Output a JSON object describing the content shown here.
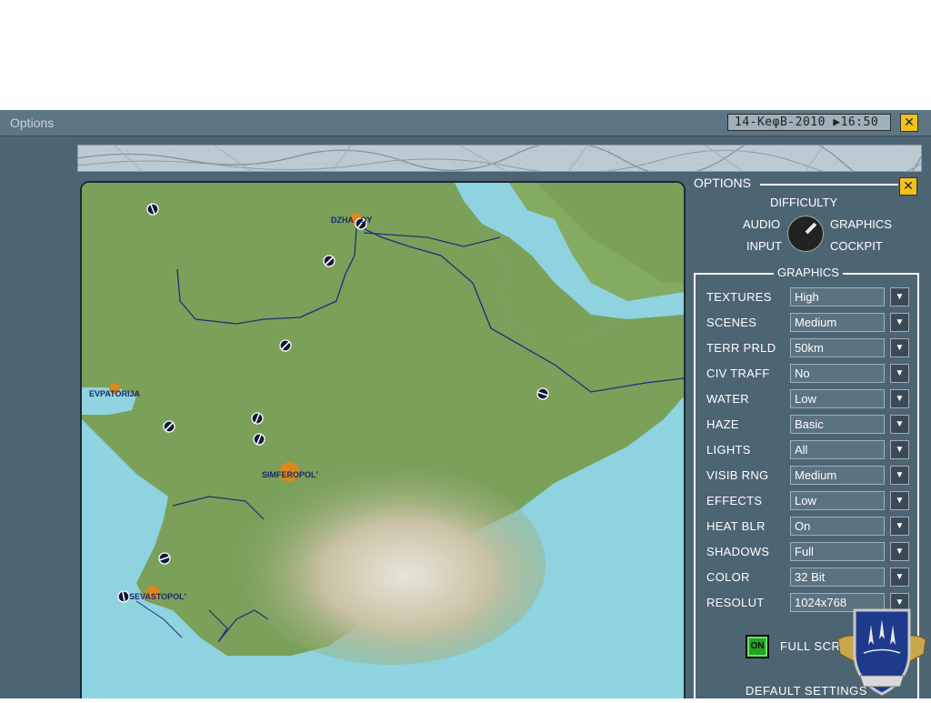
{
  "window": {
    "title": "Options",
    "datetime": "14-KeφB-2010 ▶16:50",
    "close_glyph": "✕"
  },
  "map": {
    "cities": [
      {
        "name": "DZHANKOY",
        "display": "DZHA    OY"
      },
      {
        "name": "EVPATORIJA",
        "display": "EVPATORIJA"
      },
      {
        "name": "SIMFEROPOL'",
        "display": "SIMFEROPOL'"
      },
      {
        "name": "SEVASTOPOL'",
        "display": "SEVASTOPOL'"
      }
    ]
  },
  "options": {
    "title": "OPTIONS",
    "close_glyph": "✕",
    "categories": {
      "difficulty": "DIFFICULTY",
      "audio": "AUDIO",
      "graphics": "GRAPHICS",
      "input": "INPUT",
      "cockpit": "COCKPIT"
    },
    "selected_category": "GRAPHICS"
  },
  "graphics": {
    "title": "GRAPHICS",
    "dropdown_glyph": "▼",
    "rows": [
      {
        "label": "TEXTURES",
        "value": "High"
      },
      {
        "label": "SCENES",
        "value": "Medium"
      },
      {
        "label": "TERR PRLD",
        "value": "50km"
      },
      {
        "label": "CIV TRAFF",
        "value": "No"
      },
      {
        "label": "WATER",
        "value": "Low"
      },
      {
        "label": "HAZE",
        "value": "Basic"
      },
      {
        "label": "LIGHTS",
        "value": "All"
      },
      {
        "label": "VISIB RNG",
        "value": "Medium"
      },
      {
        "label": "EFFECTS",
        "value": "Low"
      },
      {
        "label": "HEAT BLR",
        "value": "On"
      },
      {
        "label": "SHADOWS",
        "value": "Full"
      },
      {
        "label": "COLOR",
        "value": "32 Bit"
      },
      {
        "label": "RESOLUT",
        "value": "1024x768"
      }
    ],
    "full_screen": {
      "state": "ON",
      "label": "FULL SCREEN"
    },
    "default_settings": "DEFAULT SETTINGS"
  },
  "colors": {
    "panel_bg": "#4d6472",
    "close_button": "#f2c21b",
    "toggle_on": "#1fa51f",
    "map_water": "#8ed3df",
    "map_land": "#7aa05a"
  }
}
